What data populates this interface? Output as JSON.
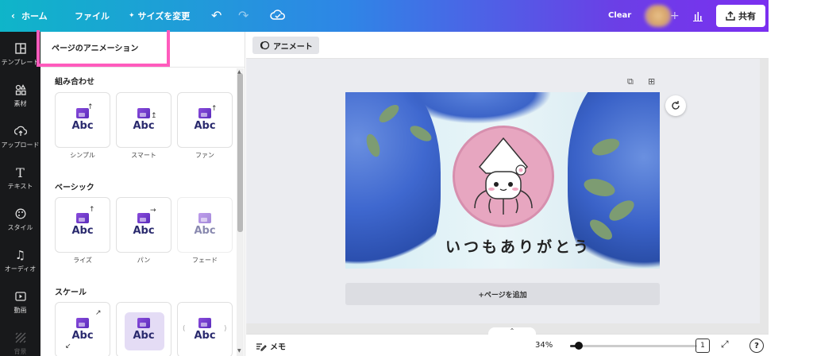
{
  "topbar": {
    "home_label": "ホーム",
    "file_label": "ファイル",
    "resize_label": "サイズを変更",
    "clear_label": "Clear",
    "share_label": "共有"
  },
  "rail": {
    "items": [
      {
        "label": "テンプレート"
      },
      {
        "label": "素材"
      },
      {
        "label": "アップロード"
      },
      {
        "label": "テキスト"
      },
      {
        "label": "スタイル"
      },
      {
        "label": "オーディオ"
      },
      {
        "label": "動画"
      },
      {
        "label": "背景"
      }
    ]
  },
  "panel": {
    "title": "ページのアニメーション",
    "sections": [
      {
        "title": "組み合わせ",
        "cards": [
          {
            "label": "シンプル"
          },
          {
            "label": "スマート"
          },
          {
            "label": "ファン"
          }
        ]
      },
      {
        "title": "ベーシック",
        "cards": [
          {
            "label": "ライズ"
          },
          {
            "label": "パン"
          },
          {
            "label": "フェード"
          }
        ]
      },
      {
        "title": "スケール",
        "cards": [
          {
            "label": ""
          },
          {
            "label": ""
          },
          {
            "label": ""
          }
        ]
      }
    ],
    "card_text": "Abc"
  },
  "canvas": {
    "animate_label": "アニメート",
    "design_text": "いつもありがとう",
    "add_page_label": "+ページを追加"
  },
  "bottombar": {
    "memo_label": "メモ",
    "zoom_label": "34%",
    "zoom_value": 0.34,
    "page_count": "1",
    "help_label": "?"
  },
  "colors": {
    "highlight": "#ff5bbd",
    "rail_bg": "#18191b",
    "workspace_bg": "#ebecf0"
  }
}
